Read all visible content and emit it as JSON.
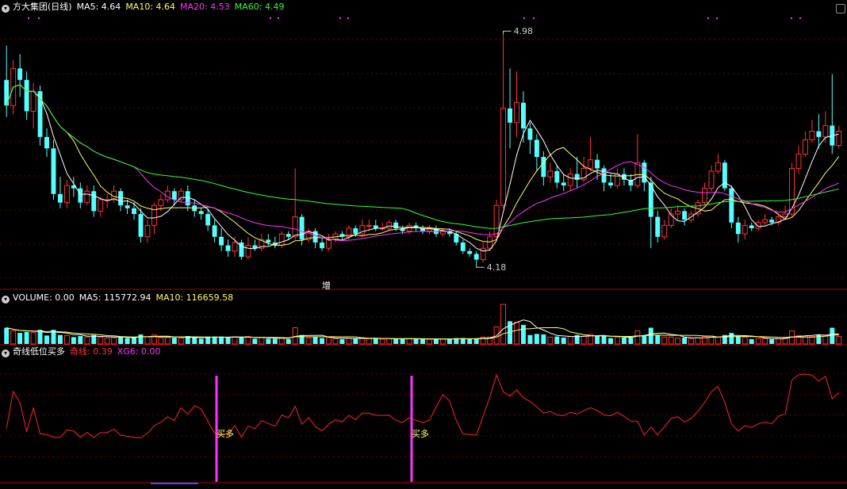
{
  "main_panel": {
    "title": "方大集团(日线)",
    "ma_labels": [
      {
        "text": "MA5: 4.64",
        "color": "#ffffff"
      },
      {
        "text": "MA10: 4.64",
        "color": "#ffff66"
      },
      {
        "text": "MA20: 4.53",
        "color": "#ff33ff"
      },
      {
        "text": "MA60: 4.49",
        "color": "#33ff33"
      }
    ],
    "max_label": "4.98",
    "min_label": "4.18",
    "marker_text": "增"
  },
  "volume_panel": {
    "labels": [
      {
        "text": "VOLUME: 0.00",
        "color": "#ffffff"
      },
      {
        "text": "MA5: 115772.94",
        "color": "#ffffff"
      },
      {
        "text": "MA10: 116659.58",
        "color": "#ffff66"
      }
    ]
  },
  "indicator_panel": {
    "title": "奇线低位买多",
    "labels": [
      {
        "text": "奇线: 0.39",
        "color": "#ff3333"
      },
      {
        "text": "XG6: 0.00",
        "color": "#ff33ff"
      }
    ],
    "signal_text": "买多"
  },
  "colors": {
    "up": "#ff3333",
    "down": "#54ffff",
    "ma5": "#ffffff",
    "ma10": "#ffff66",
    "ma20": "#ff33ff",
    "ma60": "#33ff33",
    "grid": "#7a0000"
  },
  "chart_data": {
    "type": "candlestick",
    "price_range": [
      4.1,
      5.05
    ],
    "candles": [
      [
        4.82,
        4.73,
        4.94,
        4.69
      ],
      [
        4.73,
        4.86,
        4.89,
        4.7
      ],
      [
        4.86,
        4.82,
        4.91,
        4.76
      ],
      [
        4.82,
        4.71,
        4.85,
        4.68
      ],
      [
        4.71,
        4.78,
        4.81,
        4.65
      ],
      [
        4.78,
        4.62,
        4.8,
        4.59
      ],
      [
        4.62,
        4.58,
        4.65,
        4.55
      ],
      [
        4.58,
        4.42,
        4.61,
        4.4
      ],
      [
        4.42,
        4.39,
        4.48,
        4.37
      ],
      [
        4.39,
        4.45,
        4.47,
        4.37
      ],
      [
        4.45,
        4.44,
        4.48,
        4.41
      ],
      [
        4.44,
        4.39,
        4.46,
        4.37
      ],
      [
        4.39,
        4.43,
        4.45,
        4.38
      ],
      [
        4.43,
        4.36,
        4.45,
        4.34
      ],
      [
        4.36,
        4.4,
        4.41,
        4.34
      ],
      [
        4.4,
        4.4,
        4.42,
        4.37
      ],
      [
        4.4,
        4.43,
        4.45,
        4.39
      ],
      [
        4.43,
        4.38,
        4.44,
        4.36
      ],
      [
        4.38,
        4.37,
        4.4,
        4.35
      ],
      [
        4.37,
        4.35,
        4.39,
        4.33
      ],
      [
        4.35,
        4.27,
        4.37,
        4.25
      ],
      [
        4.27,
        4.31,
        4.33,
        4.25
      ],
      [
        4.31,
        4.38,
        4.39,
        4.28
      ],
      [
        4.38,
        4.4,
        4.42,
        4.36
      ],
      [
        4.4,
        4.43,
        4.45,
        4.39
      ],
      [
        4.43,
        4.4,
        4.44,
        4.38
      ],
      [
        4.4,
        4.43,
        4.44,
        4.39
      ],
      [
        4.43,
        4.38,
        4.45,
        4.36
      ],
      [
        4.38,
        4.36,
        4.4,
        4.34
      ],
      [
        4.36,
        4.35,
        4.37,
        4.33
      ],
      [
        4.35,
        4.31,
        4.37,
        4.29
      ],
      [
        4.31,
        4.27,
        4.33,
        4.25
      ],
      [
        4.27,
        4.24,
        4.3,
        4.22
      ],
      [
        4.24,
        4.22,
        4.26,
        4.2
      ],
      [
        4.22,
        4.25,
        4.27,
        4.2
      ],
      [
        4.25,
        4.2,
        4.26,
        4.19
      ],
      [
        4.2,
        4.24,
        4.27,
        4.19
      ],
      [
        4.24,
        4.23,
        4.26,
        4.22
      ],
      [
        4.23,
        4.26,
        4.28,
        4.22
      ],
      [
        4.26,
        4.25,
        4.28,
        4.24
      ],
      [
        4.25,
        4.24,
        4.27,
        4.23
      ],
      [
        4.24,
        4.28,
        4.29,
        4.23
      ],
      [
        4.28,
        4.27,
        4.29,
        4.26
      ],
      [
        4.27,
        4.34,
        4.51,
        4.26
      ],
      [
        4.34,
        4.26,
        4.35,
        4.24
      ],
      [
        4.26,
        4.29,
        4.3,
        4.25
      ],
      [
        4.29,
        4.25,
        4.3,
        4.23
      ],
      [
        4.25,
        4.23,
        4.27,
        4.22
      ],
      [
        4.23,
        4.26,
        4.28,
        4.22
      ],
      [
        4.26,
        4.28,
        4.29,
        4.25
      ],
      [
        4.28,
        4.27,
        4.29,
        4.26
      ],
      [
        4.27,
        4.3,
        4.31,
        4.26
      ],
      [
        4.3,
        4.28,
        4.31,
        4.27
      ],
      [
        4.28,
        4.31,
        4.33,
        4.27
      ],
      [
        4.31,
        4.31,
        4.33,
        4.29
      ],
      [
        4.31,
        4.3,
        4.33,
        4.29
      ],
      [
        4.3,
        4.3,
        4.32,
        4.29
      ],
      [
        4.3,
        4.32,
        4.33,
        4.29
      ],
      [
        4.32,
        4.3,
        4.33,
        4.29
      ],
      [
        4.3,
        4.29,
        4.31,
        4.28
      ],
      [
        4.29,
        4.31,
        4.32,
        4.28
      ],
      [
        4.31,
        4.3,
        4.32,
        4.29
      ],
      [
        4.3,
        4.29,
        4.31,
        4.28
      ],
      [
        4.29,
        4.3,
        4.31,
        4.28
      ],
      [
        4.3,
        4.28,
        4.31,
        4.27
      ],
      [
        4.28,
        4.29,
        4.3,
        4.27
      ],
      [
        4.29,
        4.28,
        4.3,
        4.27
      ],
      [
        4.28,
        4.25,
        4.29,
        4.24
      ],
      [
        4.25,
        4.22,
        4.26,
        4.21
      ],
      [
        4.22,
        4.21,
        4.23,
        4.2
      ],
      [
        4.21,
        4.19,
        4.22,
        4.18
      ],
      [
        4.19,
        4.23,
        4.25,
        4.18
      ],
      [
        4.23,
        4.27,
        4.29,
        4.22
      ],
      [
        4.27,
        4.38,
        4.4,
        4.26
      ],
      [
        4.38,
        4.72,
        4.98,
        4.37
      ],
      [
        4.72,
        4.67,
        4.86,
        4.58
      ],
      [
        4.67,
        4.74,
        4.85,
        4.62
      ],
      [
        4.74,
        4.65,
        4.78,
        4.6
      ],
      [
        4.65,
        4.61,
        4.67,
        4.56
      ],
      [
        4.61,
        4.55,
        4.63,
        4.5
      ],
      [
        4.55,
        4.48,
        4.57,
        4.45
      ],
      [
        4.48,
        4.5,
        4.53,
        4.46
      ],
      [
        4.5,
        4.46,
        4.52,
        4.44
      ],
      [
        4.46,
        4.45,
        4.49,
        4.43
      ],
      [
        4.45,
        4.49,
        4.51,
        4.43
      ],
      [
        4.49,
        4.47,
        4.55,
        4.44
      ],
      [
        4.47,
        4.51,
        4.55,
        4.46
      ],
      [
        4.51,
        4.54,
        4.62,
        4.5
      ],
      [
        4.54,
        4.51,
        4.56,
        4.47
      ],
      [
        4.51,
        4.46,
        4.52,
        4.43
      ],
      [
        4.46,
        4.45,
        4.49,
        4.44
      ],
      [
        4.45,
        4.49,
        4.51,
        4.44
      ],
      [
        4.49,
        4.47,
        4.51,
        4.45
      ],
      [
        4.47,
        4.45,
        4.49,
        4.43
      ],
      [
        4.45,
        4.53,
        4.63,
        4.44
      ],
      [
        4.53,
        4.46,
        4.54,
        4.43
      ],
      [
        4.46,
        4.34,
        4.48,
        4.23
      ],
      [
        4.34,
        4.27,
        4.36,
        4.25
      ],
      [
        4.27,
        4.31,
        4.33,
        4.26
      ],
      [
        4.31,
        4.35,
        4.37,
        4.3
      ],
      [
        4.35,
        4.36,
        4.38,
        4.33
      ],
      [
        4.36,
        4.33,
        4.37,
        4.31
      ],
      [
        4.33,
        4.35,
        4.36,
        4.32
      ],
      [
        4.35,
        4.39,
        4.4,
        4.34
      ],
      [
        4.39,
        4.44,
        4.46,
        4.38
      ],
      [
        4.44,
        4.5,
        4.52,
        4.43
      ],
      [
        4.5,
        4.53,
        4.56,
        4.49
      ],
      [
        4.53,
        4.44,
        4.54,
        4.43
      ],
      [
        4.44,
        4.32,
        4.45,
        4.3
      ],
      [
        4.32,
        4.28,
        4.34,
        4.25
      ],
      [
        4.28,
        4.31,
        4.33,
        4.26
      ],
      [
        4.31,
        4.3,
        4.32,
        4.29
      ],
      [
        4.3,
        4.32,
        4.33,
        4.29
      ],
      [
        4.32,
        4.33,
        4.35,
        4.31
      ],
      [
        4.33,
        4.32,
        4.34,
        4.31
      ],
      [
        4.32,
        4.34,
        4.35,
        4.31
      ],
      [
        4.34,
        4.35,
        4.38,
        4.33
      ],
      [
        4.35,
        4.51,
        4.53,
        4.34
      ],
      [
        4.51,
        4.56,
        4.59,
        4.49
      ],
      [
        4.56,
        4.61,
        4.64,
        4.55
      ],
      [
        4.61,
        4.64,
        4.68,
        4.6
      ],
      [
        4.64,
        4.62,
        4.7,
        4.58
      ],
      [
        4.62,
        4.66,
        4.71,
        4.6
      ],
      [
        4.66,
        4.59,
        4.84,
        4.56
      ],
      [
        4.59,
        4.64,
        4.66,
        4.58
      ]
    ],
    "volume_ma5": 115772.94,
    "volume_ma10": 116659.58,
    "indicator_qixian": 0.39,
    "indicator_xg6": 0.0
  }
}
